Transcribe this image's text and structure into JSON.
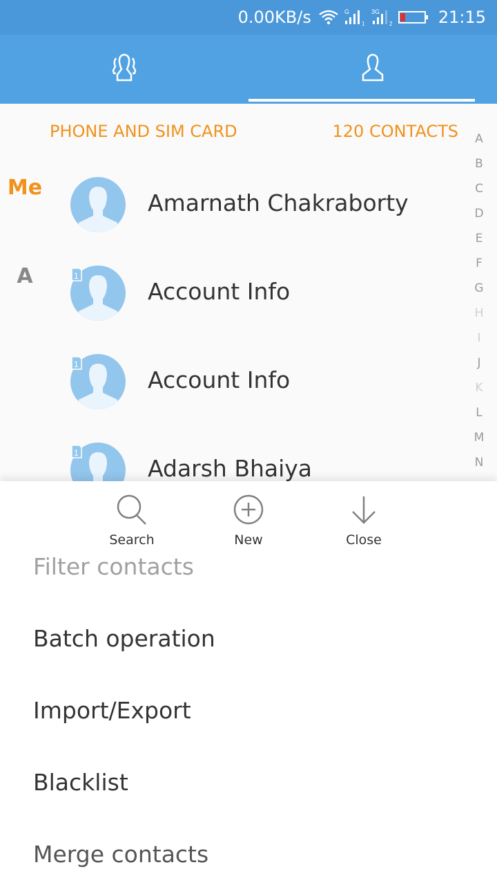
{
  "status_bar": {
    "network_speed": "0.00KB/s",
    "wifi_icon": "wifi-icon",
    "sim1_label": "G",
    "sim1_index": "1",
    "sim2_label": "3G",
    "sim2_index": "2",
    "battery_icon": "battery-low-icon",
    "battery_color": "#e0312f",
    "time": "21:15"
  },
  "tabs": [
    {
      "name": "groups",
      "icon": "groups-icon",
      "active": false
    },
    {
      "name": "contacts",
      "icon": "person-icon",
      "active": true
    }
  ],
  "colors": {
    "header": "#51a2e2",
    "status": "#4a97d9",
    "accent": "#f0921b",
    "avatar": "#93c6ec"
  },
  "list_header": {
    "source": "PHONE AND SIM CARD",
    "count": "120 CONTACTS"
  },
  "index_letters": [
    "A",
    "B",
    "C",
    "D",
    "E",
    "F",
    "G",
    "H",
    "I",
    "J",
    "K",
    "L",
    "M",
    "N"
  ],
  "contacts": [
    {
      "section": "Me",
      "name": "Amarnath Chakraborty",
      "sim_badge": ""
    },
    {
      "section": "A",
      "name": "Account Info",
      "sim_badge": "1"
    },
    {
      "section": "",
      "name": "Account Info",
      "sim_badge": "1"
    },
    {
      "section": "",
      "name": "Adarsh Bhaiya",
      "sim_badge": "1"
    }
  ],
  "sheet": {
    "actions": [
      {
        "label": "Search",
        "icon": "search-icon"
      },
      {
        "label": "New",
        "icon": "add-circle-icon"
      },
      {
        "label": "Close",
        "icon": "arrow-down-icon"
      }
    ],
    "menu": [
      "Filter contacts",
      "Batch operation",
      "Import/Export",
      "Blacklist",
      "Merge contacts"
    ]
  }
}
